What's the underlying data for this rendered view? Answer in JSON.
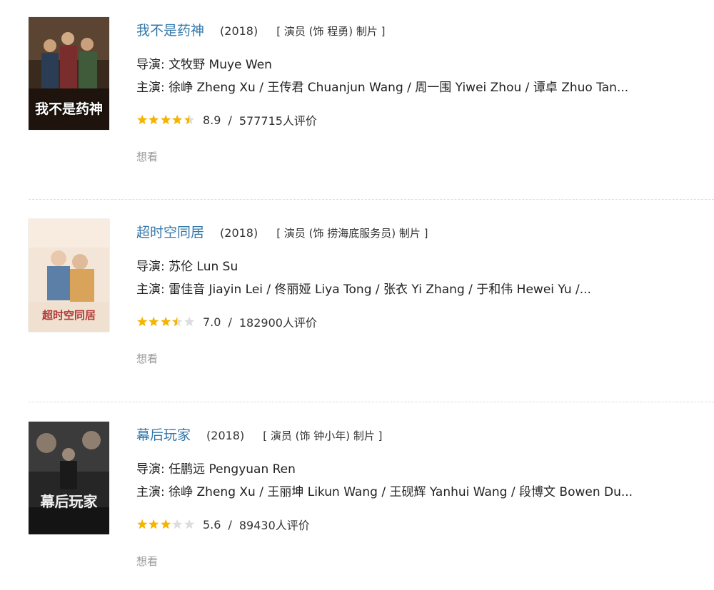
{
  "movies": [
    {
      "poster_title": "我不是药神",
      "poster_icon": "movie-poster-icon",
      "title": "我不是药神",
      "year": "(2018)",
      "role": "[ 演员 (饰 程勇) 制片 ]",
      "director": "导演: 文牧野 Muye Wen",
      "cast": "主演: 徐峥 Zheng Xu / 王传君 Chuanjun Wang / 周一围 Yiwei Zhou / 谭卓 Zhuo Tan...",
      "stars": 4.5,
      "score": "8.9",
      "sep": "/",
      "votes": "577715人评价",
      "wish": "想看"
    },
    {
      "poster_title": "超时空同居",
      "poster_icon": "movie-poster-icon",
      "title": "超时空同居",
      "year": "(2018)",
      "role": "[ 演员 (饰 捞海底服务员) 制片 ]",
      "director": "导演: 苏伦 Lun Su",
      "cast": "主演: 雷佳音 Jiayin Lei / 佟丽娅 Liya Tong / 张衣 Yi Zhang / 于和伟 Hewei Yu /...",
      "stars": 3.5,
      "score": "7.0",
      "sep": "/",
      "votes": "182900人评价",
      "wish": "想看"
    },
    {
      "poster_title": "幕后玩家",
      "poster_icon": "movie-poster-icon",
      "title": "幕后玩家",
      "year": "(2018)",
      "role": "[ 演员 (饰 钟小年) 制片 ]",
      "director": "导演: 任鹏远 Pengyuan Ren",
      "cast": "主演: 徐峥 Zheng Xu / 王丽坤 Likun Wang / 王砚辉 Yanhui Wang / 段博文 Bowen Du...",
      "stars": 3,
      "score": "5.6",
      "sep": "/",
      "votes": "89430人评价",
      "wish": "想看"
    }
  ],
  "colors": {
    "title_link": "#3377aa",
    "star_filled": "#f5b400",
    "star_empty": "#dddddd",
    "muted": "#999999"
  }
}
